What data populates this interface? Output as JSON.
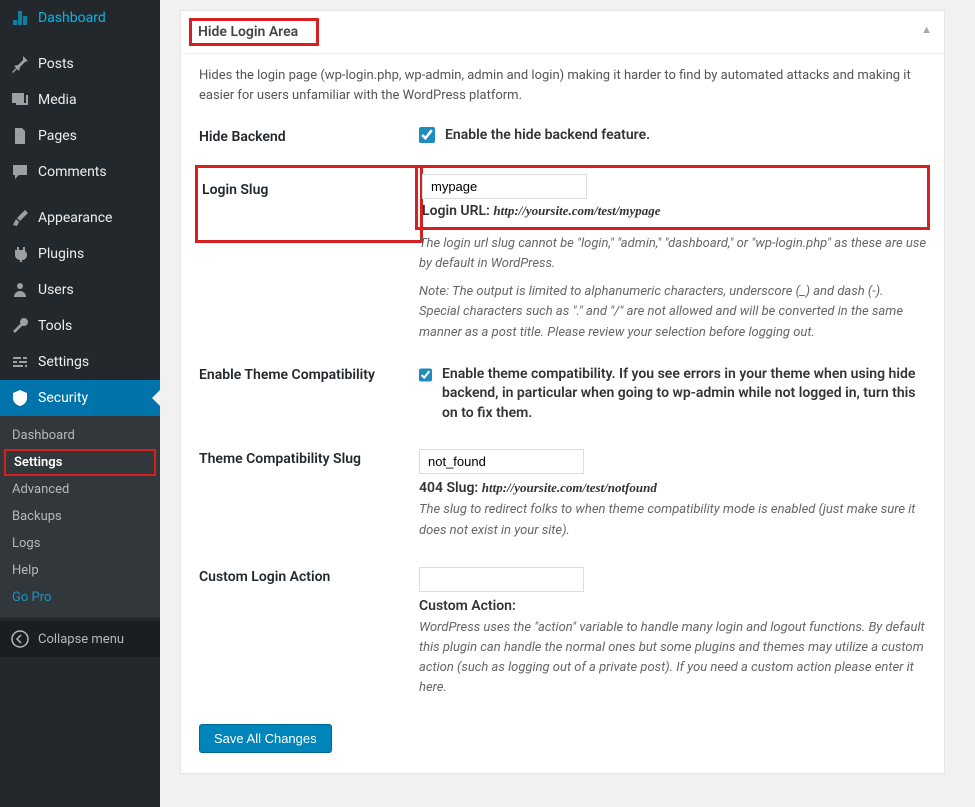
{
  "sidebar": {
    "items": [
      {
        "label": "Dashboard",
        "icon": "dashboard"
      },
      {
        "label": "Posts",
        "icon": "pin"
      },
      {
        "label": "Media",
        "icon": "media"
      },
      {
        "label": "Pages",
        "icon": "pages"
      },
      {
        "label": "Comments",
        "icon": "comment"
      },
      {
        "label": "Appearance",
        "icon": "brush"
      },
      {
        "label": "Plugins",
        "icon": "plug"
      },
      {
        "label": "Users",
        "icon": "user"
      },
      {
        "label": "Tools",
        "icon": "wrench"
      },
      {
        "label": "Settings",
        "icon": "sliders"
      },
      {
        "label": "Security",
        "icon": "shield"
      }
    ],
    "submenu": [
      {
        "label": "Dashboard"
      },
      {
        "label": "Settings"
      },
      {
        "label": "Advanced"
      },
      {
        "label": "Backups"
      },
      {
        "label": "Logs"
      },
      {
        "label": "Help"
      },
      {
        "label": "Go Pro"
      }
    ],
    "collapse": "Collapse menu"
  },
  "panel": {
    "title": "Hide Login Area",
    "description": "Hides the login page (wp-login.php, wp-admin, admin and login) making it harder to find by automated attacks and making it easier for users unfamiliar with the WordPress platform."
  },
  "rows": {
    "hide_backend": {
      "label": "Hide Backend",
      "checkbox_label": "Enable the hide backend feature.",
      "checked": true
    },
    "login_slug": {
      "label": "Login Slug",
      "value": "mypage",
      "url_label": "Login URL:",
      "url": "http://yoursite.com/test/mypage",
      "help1": "The login url slug cannot be \"login,\" \"admin,\" \"dashboard,\" or \"wp-login.php\" as these are use by default in WordPress.",
      "help2": "Note: The output is limited to alphanumeric characters, underscore (_) and dash (-). Special characters such as \".\" and \"/\" are not allowed and will be converted in the same manner as a post title. Please review your selection before logging out."
    },
    "theme_compat": {
      "label": "Enable Theme Compatibility",
      "checkbox_label": "Enable theme compatibility. If you see errors in your theme when using hide backend, in particular when going to wp-admin while not logged in, turn this on to fix them.",
      "checked": true
    },
    "compat_slug": {
      "label": "Theme Compatibility Slug",
      "value": "not_found",
      "url_label": "404 Slug:",
      "url": "http://yoursite.com/test/notfound",
      "help": "The slug to redirect folks to when theme compatibility mode is enabled (just make sure it does not exist in your site)."
    },
    "custom_action": {
      "label": "Custom Login Action",
      "value": "",
      "sublabel": "Custom Action:",
      "help": "WordPress uses the \"action\" variable to handle many login and logout functions. By default this plugin can handle the normal ones but some plugins and themes may utilize a custom action (such as logging out of a private post). If you need a custom action please enter it here."
    }
  },
  "button": "Save All Changes"
}
